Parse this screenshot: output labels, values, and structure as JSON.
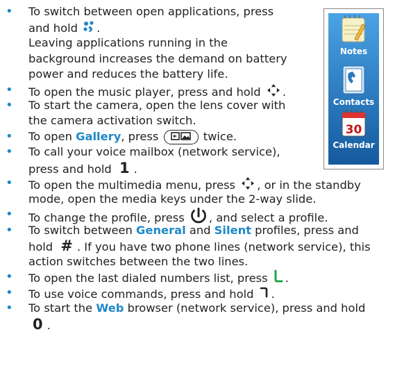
{
  "tips": [
    {
      "lines": [
        [
          "To switch between open applications, press"
        ],
        [
          "and hold ",
          {
            "icon": "apps-key-icon"
          },
          "."
        ],
        [
          "Leaving applications running in the"
        ],
        [
          "background increases the demand on battery"
        ],
        [
          "power and reduces the battery life."
        ]
      ]
    },
    {
      "lines": [
        [
          "To open the music player, press and hold ",
          {
            "icon": "multimedia-key-icon"
          },
          "."
        ]
      ]
    },
    {
      "lines": [
        [
          "To start the camera, open the lens cover with"
        ],
        [
          "the camera activation switch."
        ]
      ]
    },
    {
      "lines": [
        [
          "To open ",
          {
            "kw": "Gallery"
          },
          ", press ",
          {
            "icon": "gallery-key-icon"
          },
          " twice."
        ]
      ]
    },
    {
      "lines": [
        [
          "To call your voice mailbox (network service),"
        ],
        [
          "press and hold ",
          {
            "key": "1"
          },
          "."
        ]
      ]
    },
    {
      "lines": [
        [
          "To open the multimedia menu, press ",
          {
            "icon": "multimedia-key-icon"
          },
          ", or in the standby"
        ],
        [
          "mode, open the media keys under the 2-way slide."
        ]
      ]
    },
    {
      "lines": [
        [
          "To change the profile, press ",
          {
            "icon": "power-key-icon"
          },
          ", and select a profile."
        ]
      ]
    },
    {
      "lines": [
        [
          "To switch between ",
          {
            "kw": "General"
          },
          " and ",
          {
            "kw": "Silent"
          },
          " profiles, press and"
        ],
        [
          "hold ",
          {
            "key": "#"
          },
          ". If you have two phone lines (network service), this"
        ],
        [
          "action switches between the two lines."
        ]
      ]
    },
    {
      "lines": [
        [
          "To open the last dialed numbers list, press ",
          {
            "icon": "call-key-icon"
          },
          "."
        ]
      ]
    },
    {
      "lines": [
        [
          "To use voice commands, press and hold ",
          {
            "icon": "end-key-icon"
          },
          "."
        ]
      ]
    },
    {
      "lines": [
        [
          "To start the ",
          {
            "kw": "Web"
          },
          " browser (network service), press and hold"
        ],
        [
          {
            "key": "0"
          },
          "."
        ]
      ]
    }
  ],
  "side_panel": {
    "items": [
      {
        "label": "Notes",
        "icon": "notes-icon"
      },
      {
        "label": "Contacts",
        "icon": "contacts-icon"
      },
      {
        "label": "Calendar",
        "icon": "calendar-icon",
        "day": "30"
      }
    ]
  },
  "colors": {
    "accent": "#1e88c7",
    "text": "#222222",
    "panel_label": "#ffffff",
    "panel_bg": "#1f6bb0"
  }
}
